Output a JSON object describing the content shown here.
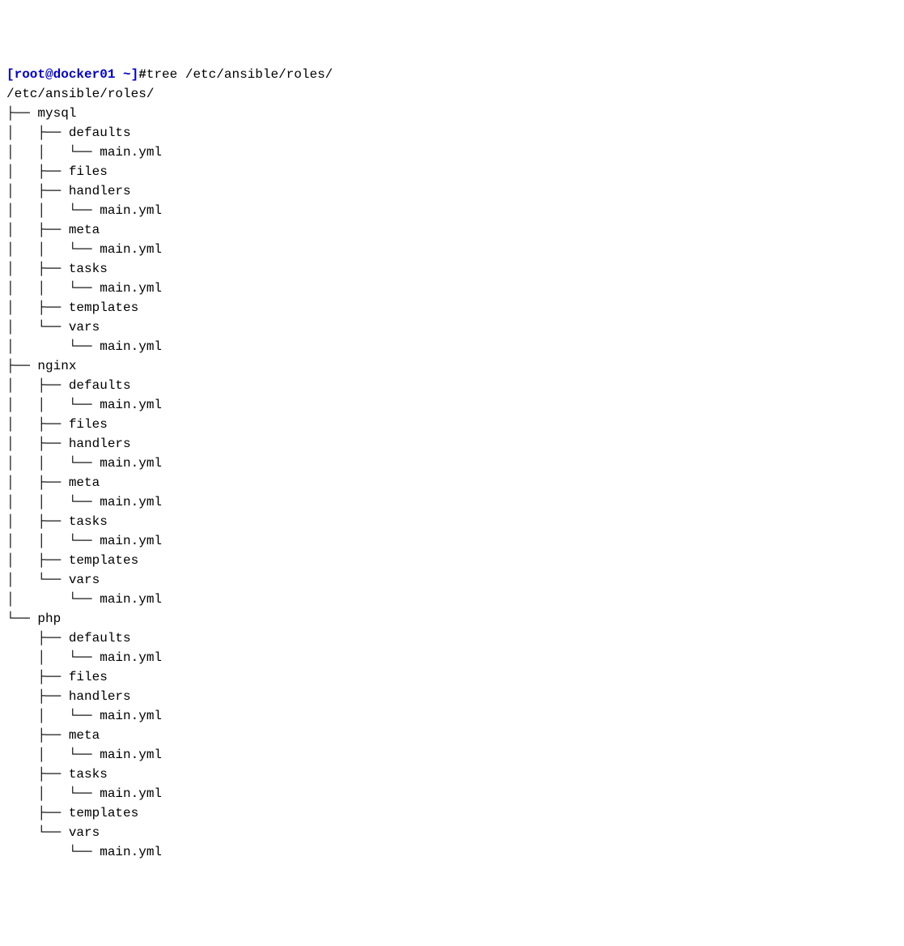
{
  "prompt": {
    "user_host": "[root@docker01 ~]",
    "hash": "#",
    "command": "tree /etc/ansible/roles/"
  },
  "root_path": "/etc/ansible/roles/",
  "roles": [
    {
      "name": "mysql",
      "dirs": [
        {
          "name": "defaults",
          "children": [
            "main.yml"
          ]
        },
        {
          "name": "files",
          "children": []
        },
        {
          "name": "handlers",
          "children": [
            "main.yml"
          ]
        },
        {
          "name": "meta",
          "children": [
            "main.yml"
          ]
        },
        {
          "name": "tasks",
          "children": [
            "main.yml"
          ]
        },
        {
          "name": "templates",
          "children": []
        },
        {
          "name": "vars",
          "children": [
            "main.yml"
          ]
        }
      ]
    },
    {
      "name": "nginx",
      "dirs": [
        {
          "name": "defaults",
          "children": [
            "main.yml"
          ]
        },
        {
          "name": "files",
          "children": []
        },
        {
          "name": "handlers",
          "children": [
            "main.yml"
          ]
        },
        {
          "name": "meta",
          "children": [
            "main.yml"
          ]
        },
        {
          "name": "tasks",
          "children": [
            "main.yml"
          ]
        },
        {
          "name": "templates",
          "children": []
        },
        {
          "name": "vars",
          "children": [
            "main.yml"
          ]
        }
      ]
    },
    {
      "name": "php",
      "dirs": [
        {
          "name": "defaults",
          "children": [
            "main.yml"
          ]
        },
        {
          "name": "files",
          "children": []
        },
        {
          "name": "handlers",
          "children": [
            "main.yml"
          ]
        },
        {
          "name": "meta",
          "children": [
            "main.yml"
          ]
        },
        {
          "name": "tasks",
          "children": [
            "main.yml"
          ]
        },
        {
          "name": "templates",
          "children": []
        },
        {
          "name": "vars",
          "children": [
            "main.yml"
          ]
        }
      ]
    }
  ]
}
